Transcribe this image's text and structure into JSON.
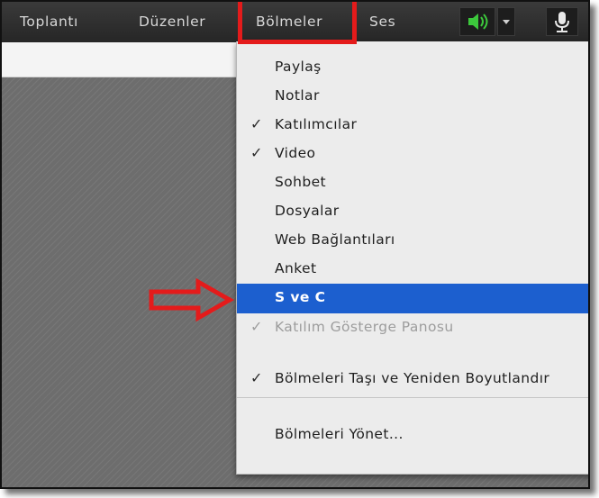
{
  "menubar": {
    "items": [
      "Toplantı",
      "Düzenler",
      "Bölmeler",
      "Ses"
    ],
    "sound_icon": "speaker-icon",
    "dropdown_icon": "caret-down-icon",
    "mic_icon": "microphone-icon"
  },
  "menu": {
    "items": [
      {
        "label": "Paylaş",
        "checked": false,
        "submenu": true
      },
      {
        "label": "Notlar",
        "checked": false,
        "submenu": true
      },
      {
        "label": "Katılımcılar",
        "checked": true,
        "submenu": false
      },
      {
        "label": "Video",
        "checked": true,
        "submenu": false
      },
      {
        "label": "Sohbet",
        "checked": false,
        "submenu": true
      },
      {
        "label": "Dosyalar",
        "checked": false,
        "submenu": true
      },
      {
        "label": "Web Bağlantıları",
        "checked": false,
        "submenu": true
      },
      {
        "label": "Anket",
        "checked": false,
        "submenu": true
      },
      {
        "label": "S ve C",
        "checked": false,
        "submenu": false,
        "highlighted": true
      },
      {
        "label": "Katılım Gösterge Panosu",
        "checked": true,
        "submenu": false,
        "disabled": true
      },
      {
        "label": "Bölmeleri Taşı ve Yeniden Boyutlandır",
        "checked": true,
        "submenu": false
      },
      {
        "label": "Bölmeleri Yönet...",
        "checked": false,
        "submenu": false
      }
    ],
    "check_glyph": "✓"
  },
  "colors": {
    "highlight": "#1c5fcf",
    "annotation": "#e41b1b",
    "speaker_green": "#3cc83c"
  }
}
